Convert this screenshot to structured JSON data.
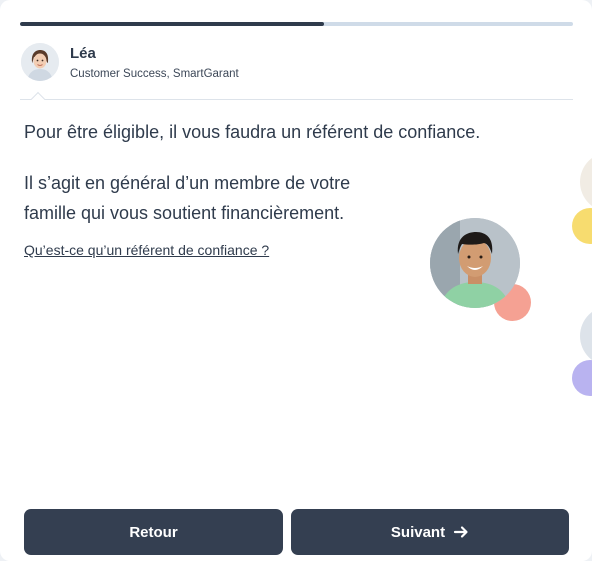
{
  "progress": {
    "fraction": 0.55
  },
  "agent": {
    "name": "Léa",
    "role": "Customer Success, SmartGarant"
  },
  "message": {
    "line1": "Pour être éligible, il vous faudra un référent de confiance.",
    "line2": "Il s’agit en général d’un membre de votre famille qui vous soutient financièrement.",
    "link": "Qu’est-ce qu’un référent de confiance ?"
  },
  "buttons": {
    "back": "Retour",
    "next": "Suivant"
  },
  "colors": {
    "primary": "#343f51",
    "accent_salmon": "#f5a193",
    "accent_yellow": "#f7dc6f",
    "accent_lavender": "#b9b3f0"
  }
}
